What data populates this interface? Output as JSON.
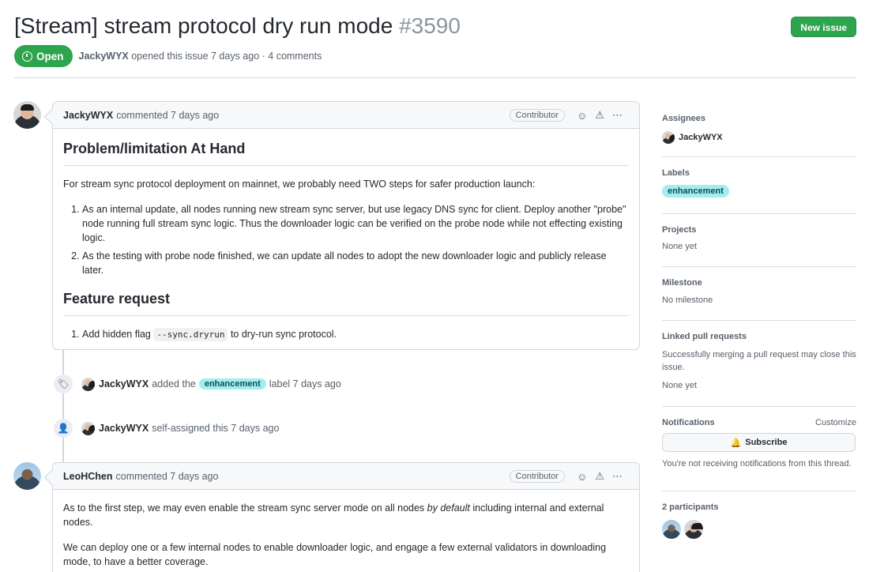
{
  "issue": {
    "title": "[Stream] stream protocol dry run mode",
    "number": "#3590",
    "new_issue_label": "New issue",
    "status": "Open",
    "author": "JackyWYX",
    "opened_text": "opened this issue 7 days ago · 4 comments"
  },
  "comments": [
    {
      "author": "JackyWYX",
      "time": "commented 7 days ago",
      "role": "Contributor",
      "heading1": "Problem/limitation At Hand",
      "para1": "For stream sync protocol deployment on mainnet, we probably need TWO steps for safer production launch:",
      "list1": [
        "As an internal update, all nodes running new stream sync server, but use legacy DNS sync for client. Deploy another \"probe\" node running full stream sync logic. Thus the downloader logic can be verified on the probe node while not effecting existing logic.",
        "As the testing with probe node finished, we can update all nodes to adopt the new downloader logic and publicly release later."
      ],
      "heading2": "Feature request",
      "list2_prefix": "Add hidden flag",
      "list2_code": "--sync.dryrun",
      "list2_suffix": "to dry-run sync protocol."
    },
    {
      "author": "LeoHChen",
      "time": "commented 7 days ago",
      "role": "Contributor",
      "para1_a": "As to the first step, we may even enable the stream sync server mode on all nodes",
      "para1_em": "by default",
      "para1_b": "including internal and external nodes.",
      "para2": "We can deploy one or a few internal nodes to enable downloader logic, and engage a few external validators in downloading mode, to have a better coverage."
    }
  ],
  "events": [
    {
      "user": "JackyWYX",
      "pre": "added the",
      "label": "enhancement",
      "post": "label 7 days ago",
      "icon": "tag-icon"
    },
    {
      "user": "JackyWYX",
      "text": "self-assigned this 7 days ago",
      "icon": "person-icon"
    }
  ],
  "sidebar": {
    "assignees_title": "Assignees",
    "assignee": "JackyWYX",
    "labels_title": "Labels",
    "label": "enhancement",
    "projects_title": "Projects",
    "projects_value": "None yet",
    "milestone_title": "Milestone",
    "milestone_value": "No milestone",
    "linked_title": "Linked pull requests",
    "linked_desc": "Successfully merging a pull request may close this issue.",
    "linked_value": "None yet",
    "notifications_title": "Notifications",
    "customize": "Customize",
    "subscribe": "Subscribe",
    "notif_desc": "You're not receiving notifications from this thread.",
    "participants_title": "2 participants"
  },
  "colors": {
    "open_green": "#2da44e",
    "label_bg": "#a2eeef",
    "label_fg": "#0b4f52"
  }
}
